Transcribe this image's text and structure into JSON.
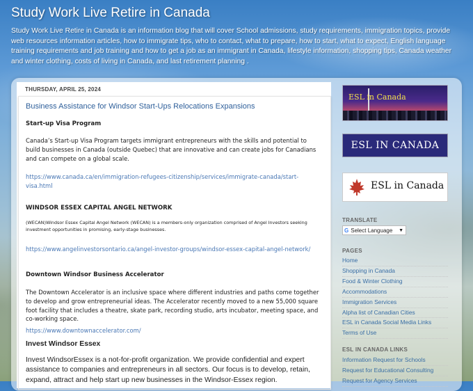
{
  "header": {
    "title": "Study Work Live Retire in Canada",
    "description": "Study Work Live Retire in Canada is an information blog that will cover School admissions, study requirements, immigration topics, provide web resources information articles, how to immigrate tips, who to contact, what to prepare, how to start, what to expect, English language training requirements and job training and how to get a job as an immigrant in Canada, lifestyle information, shopping tips, Canada weather and winter clothing, costs of living in Canada, and last retirement planning ."
  },
  "post": {
    "date": "THURSDAY, APRIL 25, 2024",
    "title": "Business Assistance for Windsor Start-Ups Relocations Expansions",
    "sections": {
      "startup_heading": "Start-up Visa Program",
      "startup_text": "Canada’s Start-up Visa Program targets immigrant entrepreneurs with the skills and potential to build businesses in Canada (outside Quebec) that are innovative and can create jobs for Canadians and can compete on a global scale.",
      "startup_link": "https://www.canada.ca/en/immigration-refugees-citizenship/services/immigrate-canada/start-visa.html",
      "wecan_heading": "WINDSOR ESSEX CAPITAL ANGEL NETWORK",
      "wecan_text": "(WECAN)Windsor Essex Capital Angel Network (WECAN) is a members-only organization comprised of Angel Investors seeking investment opportunities in promising, early-stage businesses.",
      "wecan_link": "https://www.angelinvestorsontario.ca/angel-investor-groups/windsor-essex-capital-angel-network/",
      "accel_heading": "Downtown Windsor Business Accelerator",
      "accel_text": "The Downtown Accelerator is an inclusive space where different industries and paths come together to develop and grow entrepreneurial ideas. The Accelerator recently moved to a new 55,000 square foot facility that includes a theatre, skate park, recording studio, arts incubator, meeting space, and co-working space.",
      "accel_link": "https://www.downtownaccelerator.com/",
      "invest_heading": "Invest Windsor Essex",
      "invest_text": "Invest WindsorEssex is a not-for-profit organization. We provide confidential and expert assistance to companies and entrepreneurs in all sectors. Our focus is to develop, retain, expand, attract and help start up new businesses in the Windsor-Essex region."
    }
  },
  "sidebar": {
    "logo1_text": "ESL in Canada",
    "logo2_text": "ESL IN CANADA",
    "logo3_text": "ESL in Canada",
    "translate_heading": "TRANSLATE",
    "translate_label": "Select Language",
    "translate_google": "G",
    "translate_arrow": "▼",
    "pages_heading": "PAGES",
    "pages": [
      "Home",
      "Shopping in Canada",
      "Food & Winter Clothing",
      "Accommodations",
      "Immigration Services",
      "Alpha list of Canadian Cities",
      "ESL in Canada Social Media Links",
      "Terms of Use"
    ],
    "links_heading": "ESL IN CANADA LINKS",
    "links": [
      "Information Request for Schools",
      "Request for Educational Consulting",
      "Request for Agency Services"
    ]
  }
}
